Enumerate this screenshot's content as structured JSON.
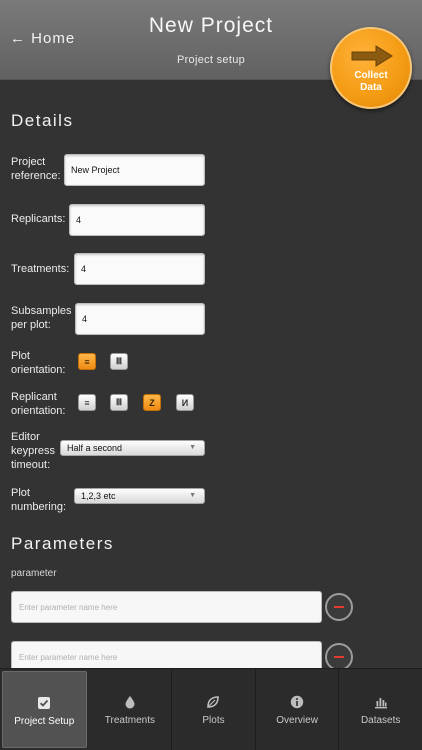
{
  "header": {
    "back_label": "← Home",
    "title": "New Project",
    "subtitle": "Project setup",
    "collect_button": {
      "line1": "Collect",
      "line2": "Data",
      "accent": "#f39a12"
    }
  },
  "details": {
    "heading": "Details",
    "project_reference": {
      "label_line1": "Project",
      "label_line2": "reference:",
      "value": "New Project"
    },
    "replicants": {
      "label": "Replicants:",
      "value": "4"
    },
    "treatments": {
      "label": "Treatments:",
      "value": "4"
    },
    "subsamples": {
      "label_line1": "Subsamples",
      "label_line2": "per plot:",
      "value": "4"
    },
    "plot_orientation": {
      "label_line1": "Plot",
      "label_line2": "orientation:",
      "options": [
        {
          "icon": "rows-icon",
          "glyph": "≡",
          "selected": true
        },
        {
          "icon": "columns-icon",
          "glyph": "Ⅲ",
          "selected": false
        }
      ]
    },
    "replicant_orientation": {
      "label_line1": "Replicant",
      "label_line2": "orientation:",
      "options": [
        {
          "icon": "rows-icon",
          "glyph": "≡",
          "selected": false
        },
        {
          "icon": "columns-icon",
          "glyph": "Ⅲ",
          "selected": false
        },
        {
          "icon": "z-pattern-icon",
          "glyph": "Z",
          "selected": true
        },
        {
          "icon": "n-pattern-icon",
          "glyph": "И",
          "selected": false
        }
      ]
    },
    "editor_timeout": {
      "label_line1": "Editor",
      "label_line2": "keypress",
      "label_line3": "timeout:",
      "value": "Half a second"
    },
    "plot_numbering": {
      "label_line1": "Plot",
      "label_line2": "numbering:",
      "value": "1,2,3 etc"
    }
  },
  "parameters": {
    "heading": "Parameters",
    "column_label": "parameter",
    "rows": [
      {
        "placeholder": "Enter parameter name here"
      },
      {
        "placeholder": "Enter parameter name here"
      }
    ]
  },
  "tabs": [
    {
      "label": "Project Setup",
      "icon": "checkbox-icon",
      "active": true
    },
    {
      "label": "Treatments",
      "icon": "droplet-icon",
      "active": false
    },
    {
      "label": "Plots",
      "icon": "leaf-icon",
      "active": false
    },
    {
      "label": "Overview",
      "icon": "info-icon",
      "active": false
    },
    {
      "label": "Datasets",
      "icon": "bar-chart-icon",
      "active": false
    }
  ]
}
